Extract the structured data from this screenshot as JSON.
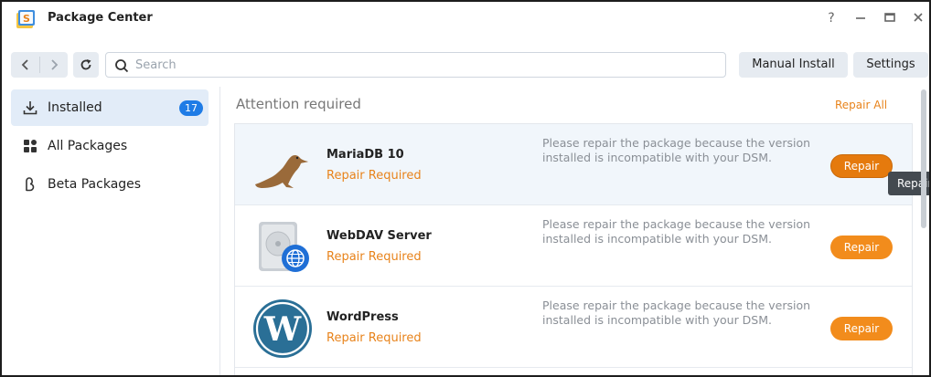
{
  "window": {
    "title": "Package Center",
    "controls": [
      "help",
      "minimize",
      "maximize",
      "close"
    ]
  },
  "toolbar": {
    "search_placeholder": "Search",
    "manual_install_label": "Manual Install",
    "settings_label": "Settings"
  },
  "sidebar": {
    "items": [
      {
        "label": "Installed",
        "icon": "download-icon",
        "badge": "17",
        "active": true
      },
      {
        "label": "All Packages",
        "icon": "grid-icon"
      },
      {
        "label": "Beta Packages",
        "icon": "beta-icon"
      }
    ]
  },
  "main": {
    "section_title": "Attention required",
    "repair_all_label": "Repair All",
    "packages": [
      {
        "name": "MariaDB 10",
        "status": "Repair Required",
        "description": "Please repair the package because the version installed is incompatible with your DSM.",
        "action": "Repair",
        "icon": "mariadb-seal-icon"
      },
      {
        "name": "WebDAV Server",
        "status": "Repair Required",
        "description": "Please repair the package because the version installed is incompatible with your DSM.",
        "action": "Repair",
        "icon": "webdav-drive-globe-icon"
      },
      {
        "name": "WordPress",
        "status": "Repair Required",
        "description": "Please repair the package because the version installed is incompatible with your DSM.",
        "action": "Repair",
        "icon": "wordpress-icon"
      }
    ]
  },
  "tooltip": {
    "text": "Repair"
  },
  "colors": {
    "accent_orange": "#f28c1c",
    "status_orange": "#e8831b",
    "badge_blue": "#1f7ce6",
    "active_item_bg": "#e2ecf8"
  }
}
